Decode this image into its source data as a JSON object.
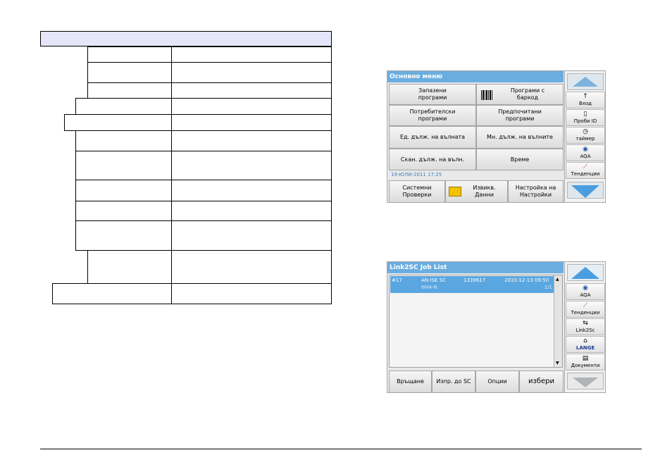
{
  "left_table": {},
  "main_menu": {
    "title": "Основно меню",
    "buttons": [
      "Запазени\nпрограми",
      "Програми с\nбаркод",
      "Потребителски\nпрограми",
      "Предпочитани\nпрограми",
      "Ед. дълж. на вълната",
      "Мн. дълж. на вълните",
      "Скан. дълж. на вълн.",
      "Време"
    ],
    "datetime": "19-ЮЛИ-2011  17:25",
    "bottom": {
      "system_checks": "Системни\nПроверки",
      "recall_data": "Извикв.\nДанни",
      "instrument_setup": "Настройка на\nНастройки"
    },
    "side": [
      "Вход",
      "Проби ID",
      "таймер",
      "AQA",
      "Тенденции"
    ]
  },
  "link2sc": {
    "title": "Link2SC Job List",
    "row": {
      "id": "#17",
      "name": "AN-ISE SC",
      "serial": "1339617",
      "datetime": "2010-12-13 09:50",
      "param": "NH4-N",
      "page": "1/1"
    },
    "bottom": [
      "Връщане",
      "Изпр. до SC",
      "Опции",
      "избери"
    ],
    "side": [
      "AQA",
      "Тенденции",
      "Link2Sc",
      "LANGE",
      "Документи"
    ]
  }
}
